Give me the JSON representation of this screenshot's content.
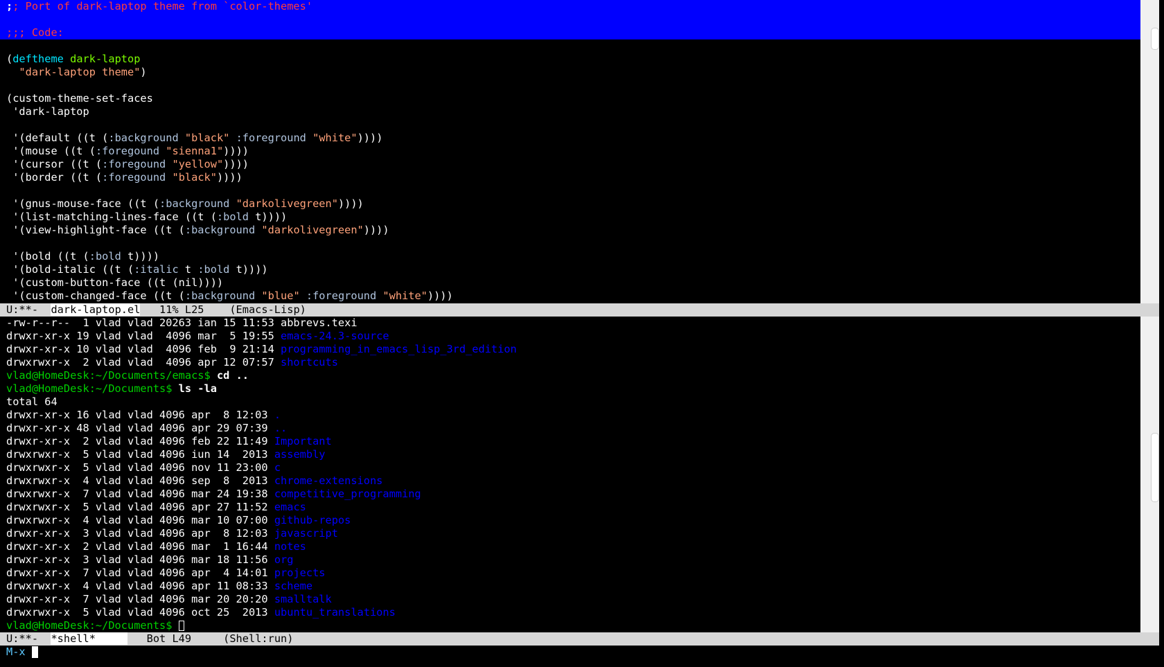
{
  "editor": {
    "lines": [
      {
        "segs": [
          {
            "t": ";",
            "c": "c-cmd"
          },
          {
            "t": "; Port of dark-laptop theme from `color-themes'",
            "c": "c-comment"
          }
        ],
        "hl": true
      },
      {
        "segs": [],
        "hl": true
      },
      {
        "segs": [
          {
            "t": ";;; Code:",
            "c": "c-comment"
          }
        ],
        "hl": true
      },
      {
        "segs": []
      },
      {
        "segs": [
          {
            "t": "("
          },
          {
            "t": "deftheme",
            "c": "c-kw"
          },
          {
            "t": " "
          },
          {
            "t": "dark-laptop",
            "c": "c-fn"
          }
        ]
      },
      {
        "segs": [
          {
            "t": "  "
          },
          {
            "t": "\"dark-laptop theme\"",
            "c": "c-str"
          },
          {
            "t": ")"
          }
        ]
      },
      {
        "segs": []
      },
      {
        "segs": [
          {
            "t": "(custom-theme-set-faces"
          }
        ]
      },
      {
        "segs": [
          {
            "t": " 'dark-laptop"
          }
        ]
      },
      {
        "segs": []
      },
      {
        "segs": [
          {
            "t": " '(default ((t ("
          },
          {
            "t": ":background",
            "c": "c-const"
          },
          {
            "t": " "
          },
          {
            "t": "\"black\"",
            "c": "c-str"
          },
          {
            "t": " "
          },
          {
            "t": ":foreground",
            "c": "c-const"
          },
          {
            "t": " "
          },
          {
            "t": "\"white\"",
            "c": "c-str"
          },
          {
            "t": "))))"
          }
        ]
      },
      {
        "segs": [
          {
            "t": " '(mouse ((t ("
          },
          {
            "t": ":foregound",
            "c": "c-const"
          },
          {
            "t": " "
          },
          {
            "t": "\"sienna1\"",
            "c": "c-str"
          },
          {
            "t": "))))"
          }
        ]
      },
      {
        "segs": [
          {
            "t": " '(cursor ((t ("
          },
          {
            "t": ":foregound",
            "c": "c-const"
          },
          {
            "t": " "
          },
          {
            "t": "\"yellow\"",
            "c": "c-str"
          },
          {
            "t": "))))"
          }
        ]
      },
      {
        "segs": [
          {
            "t": " '(border ((t ("
          },
          {
            "t": ":foregound",
            "c": "c-const"
          },
          {
            "t": " "
          },
          {
            "t": "\"black\"",
            "c": "c-str"
          },
          {
            "t": "))))"
          }
        ]
      },
      {
        "segs": []
      },
      {
        "segs": [
          {
            "t": " '(gnus-mouse-face ((t ("
          },
          {
            "t": ":background",
            "c": "c-const"
          },
          {
            "t": " "
          },
          {
            "t": "\"darkolivegreen\"",
            "c": "c-str"
          },
          {
            "t": "))))"
          }
        ]
      },
      {
        "segs": [
          {
            "t": " '(list-matching-lines-face ((t ("
          },
          {
            "t": ":bold",
            "c": "c-const"
          },
          {
            "t": " t))))"
          }
        ]
      },
      {
        "segs": [
          {
            "t": " '(view-highlight-face ((t ("
          },
          {
            "t": ":background",
            "c": "c-const"
          },
          {
            "t": " "
          },
          {
            "t": "\"darkolivegreen\"",
            "c": "c-str"
          },
          {
            "t": "))))"
          }
        ]
      },
      {
        "segs": []
      },
      {
        "segs": [
          {
            "t": " '(bold ((t ("
          },
          {
            "t": ":bold",
            "c": "c-const"
          },
          {
            "t": " t))))"
          }
        ]
      },
      {
        "segs": [
          {
            "t": " '(bold-italic ((t ("
          },
          {
            "t": ":italic",
            "c": "c-const"
          },
          {
            "t": " t "
          },
          {
            "t": ":bold",
            "c": "c-const"
          },
          {
            "t": " t))))"
          }
        ]
      },
      {
        "segs": [
          {
            "t": " '(custom-button-face ((t (nil))))"
          }
        ]
      },
      {
        "segs": [
          {
            "t": " '(custom-changed-face ((t ("
          },
          {
            "t": ":background",
            "c": "c-const"
          },
          {
            "t": " "
          },
          {
            "t": "\"blue\"",
            "c": "c-str"
          },
          {
            "t": " "
          },
          {
            "t": ":foreground",
            "c": "c-const"
          },
          {
            "t": " "
          },
          {
            "t": "\"white\"",
            "c": "c-str"
          },
          {
            "t": "))))"
          }
        ]
      }
    ]
  },
  "modeline_top": {
    "status": "U:**-  ",
    "buffer": "dark-laptop.el",
    "position": "   11% L25    ",
    "mode": "(Emacs-Lisp)"
  },
  "shell": {
    "lines": [
      {
        "segs": [
          {
            "t": "-rw-r--r--  1 vlad vlad 20263 ian 15 11:53 abbrevs.texi"
          }
        ]
      },
      {
        "segs": [
          {
            "t": "drwxr-xr-x 19 vlad vlad  4096 mar  5 19:55 "
          },
          {
            "t": "emacs-24.3-source",
            "c": "c-dir"
          }
        ]
      },
      {
        "segs": [
          {
            "t": "drwxr-xr-x 10 vlad vlad  4096 feb  9 21:14 "
          },
          {
            "t": "programming_in_emacs_lisp_3rd_edition",
            "c": "c-dir"
          }
        ]
      },
      {
        "segs": [
          {
            "t": "drwxrwxr-x  2 vlad vlad  4096 apr 12 07:57 "
          },
          {
            "t": "shortcuts",
            "c": "c-dir"
          }
        ]
      },
      {
        "segs": [
          {
            "t": "vlad@HomeDesk:~/Documents/emacs$",
            "c": "c-prompt"
          },
          {
            "t": " "
          },
          {
            "t": "cd ..",
            "c": "c-cmd"
          }
        ]
      },
      {
        "segs": [
          {
            "t": "vlad@HomeDesk:~/Documents$",
            "c": "c-prompt"
          },
          {
            "t": " "
          },
          {
            "t": "ls -la",
            "c": "c-cmd"
          }
        ]
      },
      {
        "segs": [
          {
            "t": "total 64"
          }
        ]
      },
      {
        "segs": [
          {
            "t": "drwxr-xr-x 16 vlad vlad 4096 apr  8 12:03 "
          },
          {
            "t": ".",
            "c": "c-dir"
          }
        ]
      },
      {
        "segs": [
          {
            "t": "drwxr-xr-x 48 vlad vlad 4096 apr 29 07:39 "
          },
          {
            "t": "..",
            "c": "c-dir"
          }
        ]
      },
      {
        "segs": [
          {
            "t": "drwxr-xr-x  2 vlad vlad 4096 feb 22 11:49 "
          },
          {
            "t": "Important",
            "c": "c-dir"
          }
        ]
      },
      {
        "segs": [
          {
            "t": "drwxrwxr-x  5 vlad vlad 4096 iun 14  2013 "
          },
          {
            "t": "assembly",
            "c": "c-dir"
          }
        ]
      },
      {
        "segs": [
          {
            "t": "drwxrwxr-x  5 vlad vlad 4096 nov 11 23:00 "
          },
          {
            "t": "c",
            "c": "c-dir"
          }
        ]
      },
      {
        "segs": [
          {
            "t": "drwxrwxr-x  4 vlad vlad 4096 sep  8  2013 "
          },
          {
            "t": "chrome-extensions",
            "c": "c-dir"
          }
        ]
      },
      {
        "segs": [
          {
            "t": "drwxrwxr-x  7 vlad vlad 4096 mar 24 19:38 "
          },
          {
            "t": "competitive_programming",
            "c": "c-dir"
          }
        ]
      },
      {
        "segs": [
          {
            "t": "drwxrwxr-x  5 vlad vlad 4096 apr 27 11:52 "
          },
          {
            "t": "emacs",
            "c": "c-dir"
          }
        ]
      },
      {
        "segs": [
          {
            "t": "drwxrwxr-x  4 vlad vlad 4096 mar 10 07:00 "
          },
          {
            "t": "github-repos",
            "c": "c-dir"
          }
        ]
      },
      {
        "segs": [
          {
            "t": "drwxr-xr-x  3 vlad vlad 4096 apr  8 12:03 "
          },
          {
            "t": "javascript",
            "c": "c-dir"
          }
        ]
      },
      {
        "segs": [
          {
            "t": "drwxr-xr-x  2 vlad vlad 4096 mar  1 16:44 "
          },
          {
            "t": "notes",
            "c": "c-dir"
          }
        ]
      },
      {
        "segs": [
          {
            "t": "drwxr-xr-x  3 vlad vlad 4096 mar 18 11:56 "
          },
          {
            "t": "org",
            "c": "c-dir"
          }
        ]
      },
      {
        "segs": [
          {
            "t": "drwxr-xr-x  7 vlad vlad 4096 apr  4 14:01 "
          },
          {
            "t": "projects",
            "c": "c-dir"
          }
        ]
      },
      {
        "segs": [
          {
            "t": "drwxrwxr-x  4 vlad vlad 4096 apr 11 08:33 "
          },
          {
            "t": "scheme",
            "c": "c-dir"
          }
        ]
      },
      {
        "segs": [
          {
            "t": "drwxr-xr-x  7 vlad vlad 4096 mar 20 20:20 "
          },
          {
            "t": "smalltalk",
            "c": "c-dir"
          }
        ]
      },
      {
        "segs": [
          {
            "t": "drwxrwxr-x  5 vlad vlad 4096 oct 25  2013 "
          },
          {
            "t": "ubuntu_translations",
            "c": "c-dir"
          }
        ]
      },
      {
        "segs": [
          {
            "t": "vlad@HomeDesk:~/Documents$",
            "c": "c-prompt"
          },
          {
            "t": " "
          }
        ],
        "cursor": true
      }
    ]
  },
  "modeline_bottom": {
    "status": "U:**-  ",
    "buffer": "*shell*     ",
    "position": "   Bot L49     ",
    "mode": "(Shell:run)"
  },
  "minibuffer": {
    "prompt": "M-x"
  },
  "colors": {
    "background": "#000000",
    "region_highlight": "#0000ff",
    "comment": "#ff3b3b",
    "keyword": "#00e5ff",
    "function_name": "#7cfc00",
    "string": "#ffa27a",
    "directory": "#0000ff",
    "prompt": "#00d000",
    "modeline_bg": "#d6d6d6"
  }
}
